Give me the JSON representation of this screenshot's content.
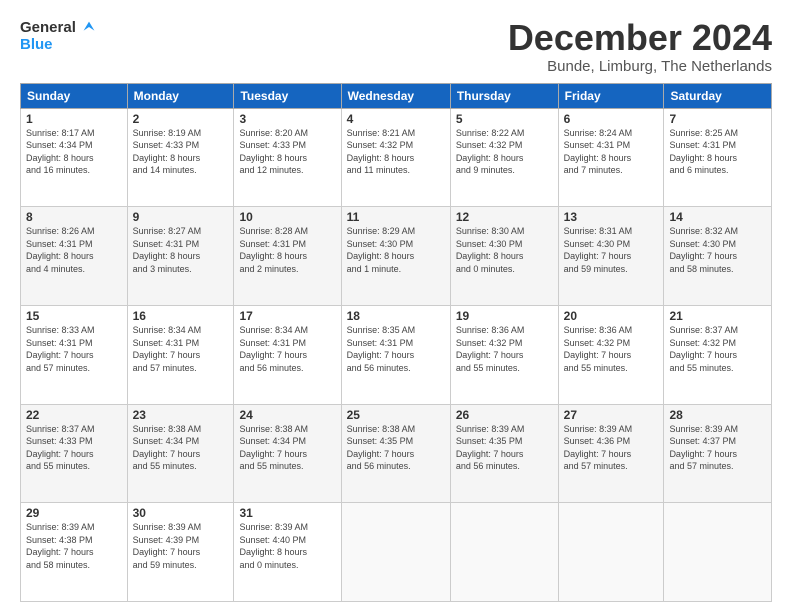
{
  "header": {
    "logo_general": "General",
    "logo_blue": "Blue",
    "title": "December 2024",
    "location": "Bunde, Limburg, The Netherlands"
  },
  "weekdays": [
    "Sunday",
    "Monday",
    "Tuesday",
    "Wednesday",
    "Thursday",
    "Friday",
    "Saturday"
  ],
  "weeks": [
    [
      {
        "day": "1",
        "info": "Sunrise: 8:17 AM\nSunset: 4:34 PM\nDaylight: 8 hours\nand 16 minutes."
      },
      {
        "day": "2",
        "info": "Sunrise: 8:19 AM\nSunset: 4:33 PM\nDaylight: 8 hours\nand 14 minutes."
      },
      {
        "day": "3",
        "info": "Sunrise: 8:20 AM\nSunset: 4:33 PM\nDaylight: 8 hours\nand 12 minutes."
      },
      {
        "day": "4",
        "info": "Sunrise: 8:21 AM\nSunset: 4:32 PM\nDaylight: 8 hours\nand 11 minutes."
      },
      {
        "day": "5",
        "info": "Sunrise: 8:22 AM\nSunset: 4:32 PM\nDaylight: 8 hours\nand 9 minutes."
      },
      {
        "day": "6",
        "info": "Sunrise: 8:24 AM\nSunset: 4:31 PM\nDaylight: 8 hours\nand 7 minutes."
      },
      {
        "day": "7",
        "info": "Sunrise: 8:25 AM\nSunset: 4:31 PM\nDaylight: 8 hours\nand 6 minutes."
      }
    ],
    [
      {
        "day": "8",
        "info": "Sunrise: 8:26 AM\nSunset: 4:31 PM\nDaylight: 8 hours\nand 4 minutes."
      },
      {
        "day": "9",
        "info": "Sunrise: 8:27 AM\nSunset: 4:31 PM\nDaylight: 8 hours\nand 3 minutes."
      },
      {
        "day": "10",
        "info": "Sunrise: 8:28 AM\nSunset: 4:31 PM\nDaylight: 8 hours\nand 2 minutes."
      },
      {
        "day": "11",
        "info": "Sunrise: 8:29 AM\nSunset: 4:30 PM\nDaylight: 8 hours\nand 1 minute."
      },
      {
        "day": "12",
        "info": "Sunrise: 8:30 AM\nSunset: 4:30 PM\nDaylight: 8 hours\nand 0 minutes."
      },
      {
        "day": "13",
        "info": "Sunrise: 8:31 AM\nSunset: 4:30 PM\nDaylight: 7 hours\nand 59 minutes."
      },
      {
        "day": "14",
        "info": "Sunrise: 8:32 AM\nSunset: 4:30 PM\nDaylight: 7 hours\nand 58 minutes."
      }
    ],
    [
      {
        "day": "15",
        "info": "Sunrise: 8:33 AM\nSunset: 4:31 PM\nDaylight: 7 hours\nand 57 minutes."
      },
      {
        "day": "16",
        "info": "Sunrise: 8:34 AM\nSunset: 4:31 PM\nDaylight: 7 hours\nand 57 minutes."
      },
      {
        "day": "17",
        "info": "Sunrise: 8:34 AM\nSunset: 4:31 PM\nDaylight: 7 hours\nand 56 minutes."
      },
      {
        "day": "18",
        "info": "Sunrise: 8:35 AM\nSunset: 4:31 PM\nDaylight: 7 hours\nand 56 minutes."
      },
      {
        "day": "19",
        "info": "Sunrise: 8:36 AM\nSunset: 4:32 PM\nDaylight: 7 hours\nand 55 minutes."
      },
      {
        "day": "20",
        "info": "Sunrise: 8:36 AM\nSunset: 4:32 PM\nDaylight: 7 hours\nand 55 minutes."
      },
      {
        "day": "21",
        "info": "Sunrise: 8:37 AM\nSunset: 4:32 PM\nDaylight: 7 hours\nand 55 minutes."
      }
    ],
    [
      {
        "day": "22",
        "info": "Sunrise: 8:37 AM\nSunset: 4:33 PM\nDaylight: 7 hours\nand 55 minutes."
      },
      {
        "day": "23",
        "info": "Sunrise: 8:38 AM\nSunset: 4:34 PM\nDaylight: 7 hours\nand 55 minutes."
      },
      {
        "day": "24",
        "info": "Sunrise: 8:38 AM\nSunset: 4:34 PM\nDaylight: 7 hours\nand 55 minutes."
      },
      {
        "day": "25",
        "info": "Sunrise: 8:38 AM\nSunset: 4:35 PM\nDaylight: 7 hours\nand 56 minutes."
      },
      {
        "day": "26",
        "info": "Sunrise: 8:39 AM\nSunset: 4:35 PM\nDaylight: 7 hours\nand 56 minutes."
      },
      {
        "day": "27",
        "info": "Sunrise: 8:39 AM\nSunset: 4:36 PM\nDaylight: 7 hours\nand 57 minutes."
      },
      {
        "day": "28",
        "info": "Sunrise: 8:39 AM\nSunset: 4:37 PM\nDaylight: 7 hours\nand 57 minutes."
      }
    ],
    [
      {
        "day": "29",
        "info": "Sunrise: 8:39 AM\nSunset: 4:38 PM\nDaylight: 7 hours\nand 58 minutes."
      },
      {
        "day": "30",
        "info": "Sunrise: 8:39 AM\nSunset: 4:39 PM\nDaylight: 7 hours\nand 59 minutes."
      },
      {
        "day": "31",
        "info": "Sunrise: 8:39 AM\nSunset: 4:40 PM\nDaylight: 8 hours\nand 0 minutes."
      },
      null,
      null,
      null,
      null
    ]
  ]
}
